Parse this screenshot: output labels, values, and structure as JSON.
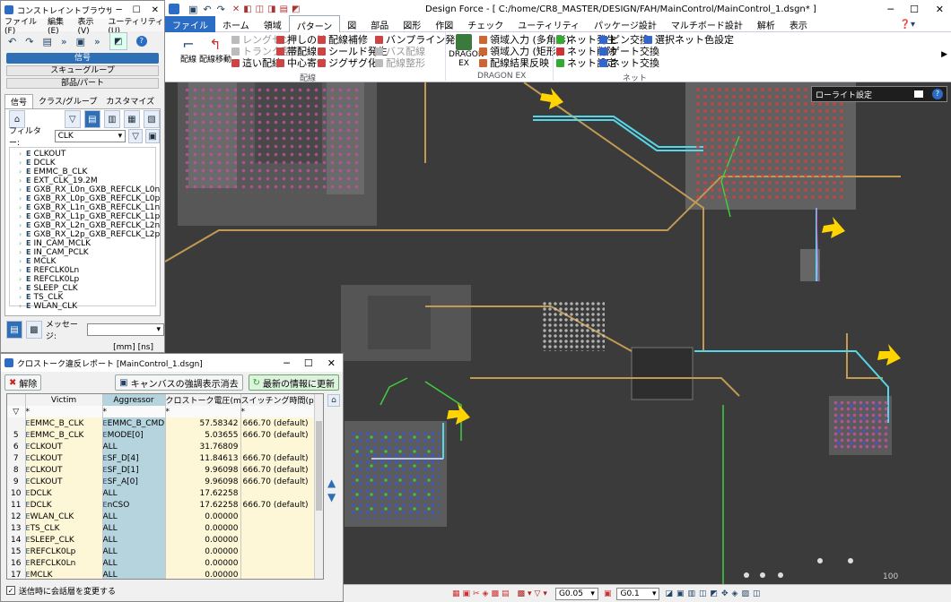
{
  "constraint_window": {
    "title": "コンストレイントブラウザー...",
    "menu": [
      "ファイル(F)",
      "編集(E)",
      "表示(V)",
      "ユーティリティ(U)"
    ],
    "mode_buttons": [
      "信号",
      "スキューグループ",
      "部品/パート"
    ],
    "tabs": [
      "信号",
      "クラス/グループ",
      "カスタマイズ"
    ],
    "filter_label": "フィルター:",
    "filter_value": "CLK",
    "signals": [
      "CLKOUT",
      "DCLK",
      "EMMC_B_CLK",
      "EXT_CLK_19.2M",
      "GXB_RX_L0n_GXB_REFCLK_L0n",
      "GXB_RX_L0p_GXB_REFCLK_L0p",
      "GXB_RX_L1n_GXB_REFCLK_L1n",
      "GXB_RX_L1p_GXB_REFCLK_L1p",
      "GXB_RX_L2n_GXB_REFCLK_L2n",
      "GXB_RX_L2p_GXB_REFCLK_L2p",
      "IN_CAM_MCLK",
      "IN_CAM_PCLK",
      "MCLK",
      "REFCLK0Ln",
      "REFCLK0Lp",
      "SLEEP_CLK",
      "TS_CLK",
      "WLAN_CLK"
    ],
    "message_label": "メッセージ:",
    "units": "[mm] [ns]"
  },
  "main_window": {
    "title": "Design Force - [ C:/home/CR8_MASTER/DESIGN/FAH/MainControl/MainControl_1.dsgn* ]",
    "ribbon_tabs": [
      "ファイル",
      "ホーム",
      "領域",
      "パターン",
      "図",
      "部品",
      "図形",
      "作図",
      "チェック",
      "ユーティリティ",
      "パッケージ設計",
      "マルチボード設計",
      "解析",
      "表示"
    ],
    "active_tab": "パターン",
    "big_buttons": [
      "配線",
      "配線移動"
    ],
    "group1_col1": [
      "レングセン",
      "トランク整形",
      "這い配線"
    ],
    "group1_col2": [
      "押しのけ",
      "帯配線",
      "中心寄せ"
    ],
    "group1_col3": [
      "配線補修",
      "シールド発生",
      "ジグザグ化"
    ],
    "group1_col4": [
      "バンプライン発生",
      "バス配線",
      "配線整形"
    ],
    "group1_label": "配線",
    "dragon_button": "DRAGON EX",
    "dragon_items": [
      "領域入力 (多角形)",
      "領域入力 (矩形)",
      "配線結果反映"
    ],
    "dragon_label": "DRAGON EX",
    "net_col1": [
      "ネット発生",
      "ネット削除",
      "ネット設定"
    ],
    "net_col2": [
      "ピン交換",
      "ゲート交換",
      "ネット交換"
    ],
    "net_col3": [
      "選択ネット色設定"
    ],
    "net_label": "ネット",
    "lowlight_label": "ローライト設定",
    "status": {
      "grid1": "G0.05",
      "grid2": "G0.1"
    },
    "canvas_labels": [
      "100",
      "100"
    ]
  },
  "crosstalk": {
    "title": "クロストーク違反レポート [MainControl_1.dsgn]",
    "cancel_label": "解除",
    "highlight_clear_label": "キャンバスの強調表示消去",
    "refresh_label": "最新の情報に更新",
    "columns": [
      "Victim",
      "Aggressor",
      "クロストーク電圧(mV)",
      "スイッチング時間(ps)"
    ],
    "filter_row": [
      "*",
      "*",
      "*",
      "*"
    ],
    "rows": [
      {
        "no": "",
        "victim": "EMMC_B_CLK",
        "aggressor": "EMMC_B_CMD",
        "voltage": "57.58342",
        "time": "666.70 (default)"
      },
      {
        "no": "5",
        "victim": "EMMC_B_CLK",
        "aggressor": "MODE[0]",
        "voltage": "5.03655",
        "time": "666.70 (default)"
      },
      {
        "no": "6",
        "victim": "CLKOUT",
        "aggressor": "ALL",
        "voltage": "31.76809",
        "time": ""
      },
      {
        "no": "7",
        "victim": "CLKOUT",
        "aggressor": "SF_D[4]",
        "voltage": "11.84613",
        "time": "666.70 (default)"
      },
      {
        "no": "8",
        "victim": "CLKOUT",
        "aggressor": "SF_D[1]",
        "voltage": "9.96098",
        "time": "666.70 (default)"
      },
      {
        "no": "9",
        "victim": "CLKOUT",
        "aggressor": "SF_A[0]",
        "voltage": "9.96098",
        "time": "666.70 (default)"
      },
      {
        "no": "10",
        "victim": "DCLK",
        "aggressor": "ALL",
        "voltage": "17.62258",
        "time": ""
      },
      {
        "no": "11",
        "victim": "DCLK",
        "aggressor": "nCSO",
        "voltage": "17.62258",
        "time": "666.70 (default)"
      },
      {
        "no": "12",
        "victim": "WLAN_CLK",
        "aggressor": "ALL",
        "voltage": "0.00000",
        "time": ""
      },
      {
        "no": "13",
        "victim": "TS_CLK",
        "aggressor": "ALL",
        "voltage": "0.00000",
        "time": ""
      },
      {
        "no": "14",
        "victim": "SLEEP_CLK",
        "aggressor": "ALL",
        "voltage": "0.00000",
        "time": ""
      },
      {
        "no": "15",
        "victim": "REFCLK0Lp",
        "aggressor": "ALL",
        "voltage": "0.00000",
        "time": ""
      },
      {
        "no": "16",
        "victim": "REFCLK0Ln",
        "aggressor": "ALL",
        "voltage": "0.00000",
        "time": ""
      },
      {
        "no": "17",
        "victim": "MCLK",
        "aggressor": "ALL",
        "voltage": "0.00000",
        "time": ""
      }
    ],
    "footer_checkbox": "送信時に会話層を変更する"
  },
  "colors": {
    "victim_bg": "#fdf6d7",
    "aggressor_bg": "#b6d4de",
    "active_blue": "#2f6fb5",
    "trace_cyan": "#56d6e8",
    "trace_orange": "#c29a52",
    "trace_green": "#3fcf3f",
    "marker_yellow": "#ffd400"
  }
}
